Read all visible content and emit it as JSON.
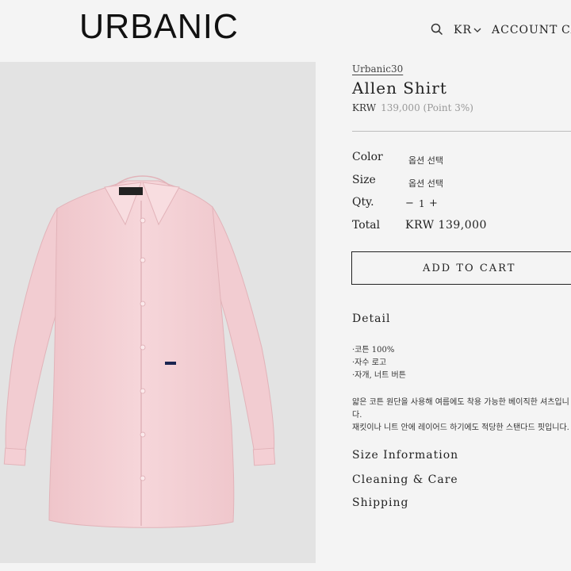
{
  "header": {
    "logo": "URBANIC",
    "lang": "KR",
    "account": "ACCOUNT",
    "cart": "CART"
  },
  "product": {
    "brand": "Urbanic30",
    "name": "Allen Shirt",
    "currency": "KRW",
    "price": "139,000",
    "points": "(Point 3%)",
    "options": {
      "color_label": "Color",
      "color_value": "옵션 선택",
      "size_label": "Size",
      "size_value": "옵션 선택",
      "qty_label": "Qty.",
      "qty_minus": "−",
      "qty_value": "1",
      "qty_plus": "+",
      "total_label": "Total",
      "total_value": "KRW 139,000"
    },
    "add_to_cart": "ADD TO CART",
    "detail": {
      "heading": "Detail",
      "bullets": [
        "·코튼 100%",
        "·자수 로고",
        "·자개, 너트 버튼"
      ],
      "desc_lines": [
        "얇은 코튼 원단을 사용해 여름에도 착용 가능한 베이직한 셔츠입니",
        "다.",
        "재킷이나 니트 안에 레이어드 하기에도 적당한 스탠다드 핏입니다."
      ]
    },
    "sections": [
      "Size Information",
      "Cleaning & Care",
      "Shipping"
    ],
    "image_alt": "Pink Allen Shirt product photo",
    "shirt_color": "#f5d2d6"
  }
}
